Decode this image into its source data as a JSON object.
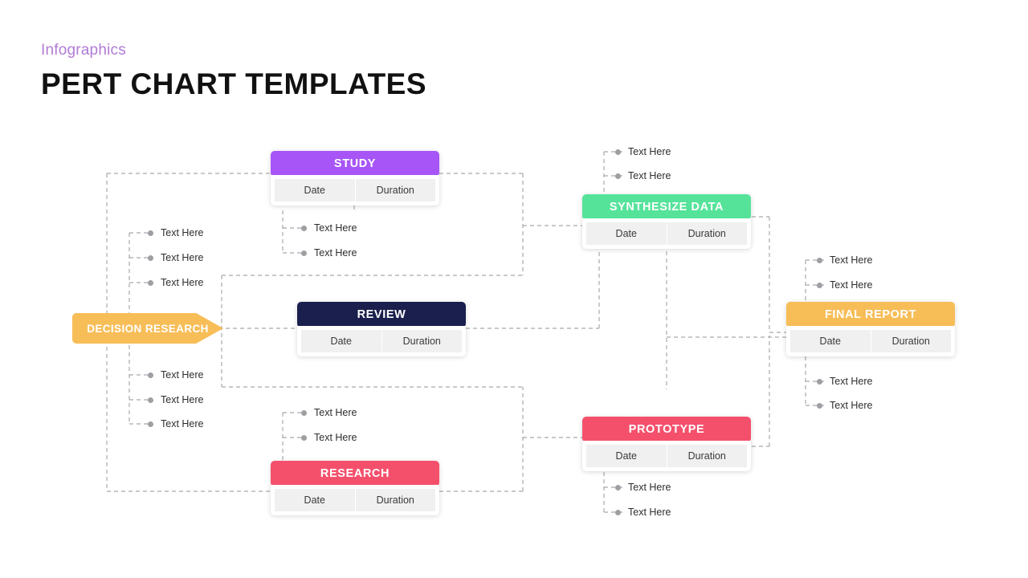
{
  "header": {
    "kicker": "Infographics",
    "title": "PERT CHART TEMPLATES"
  },
  "start_node": {
    "label": "DECISION RESEARCH",
    "color": "#f7bd57"
  },
  "labels": {
    "date": "Date",
    "duration": "Duration",
    "text_here": "Text Here"
  },
  "cards": [
    {
      "id": "study",
      "title": "STUDY",
      "color": "#a855f7",
      "date": "Date",
      "duration": "Duration"
    },
    {
      "id": "review",
      "title": "REVIEW",
      "color": "#1a1f4d",
      "date": "Date",
      "duration": "Duration"
    },
    {
      "id": "research",
      "title": "RESEARCH",
      "color": "#f4506c",
      "date": "Date",
      "duration": "Duration"
    },
    {
      "id": "synth",
      "title": "SYNTHESIZE DATA",
      "color": "#55e39a",
      "date": "Date",
      "duration": "Duration"
    },
    {
      "id": "proto",
      "title": "PROTOTYPE",
      "color": "#f4506c",
      "date": "Date",
      "duration": "Duration"
    },
    {
      "id": "final",
      "title": "FINAL REPORT",
      "color": "#f7bd57",
      "date": "Date",
      "duration": "Duration"
    }
  ],
  "details": {
    "start_upper": [
      "Text Here",
      "Text Here",
      "Text Here"
    ],
    "start_lower": [
      "Text Here",
      "Text Here",
      "Text Here"
    ],
    "study_below": [
      "Text Here",
      "Text Here"
    ],
    "research_above": [
      "Text Here",
      "Text Here"
    ],
    "synth_above": [
      "Text Here",
      "Text Here"
    ],
    "proto_below": [
      "Text Here",
      "Text Here"
    ],
    "final_above": [
      "Text Here",
      "Text Here"
    ],
    "final_below": [
      "Text Here",
      "Text Here"
    ]
  },
  "palette": {
    "purple": "#a855f7",
    "navy": "#1a1f4d",
    "pink": "#f4506c",
    "green": "#55e39a",
    "amber": "#f7bd57",
    "wire": "#a9a9ad",
    "kicker": "#b07bd4"
  }
}
